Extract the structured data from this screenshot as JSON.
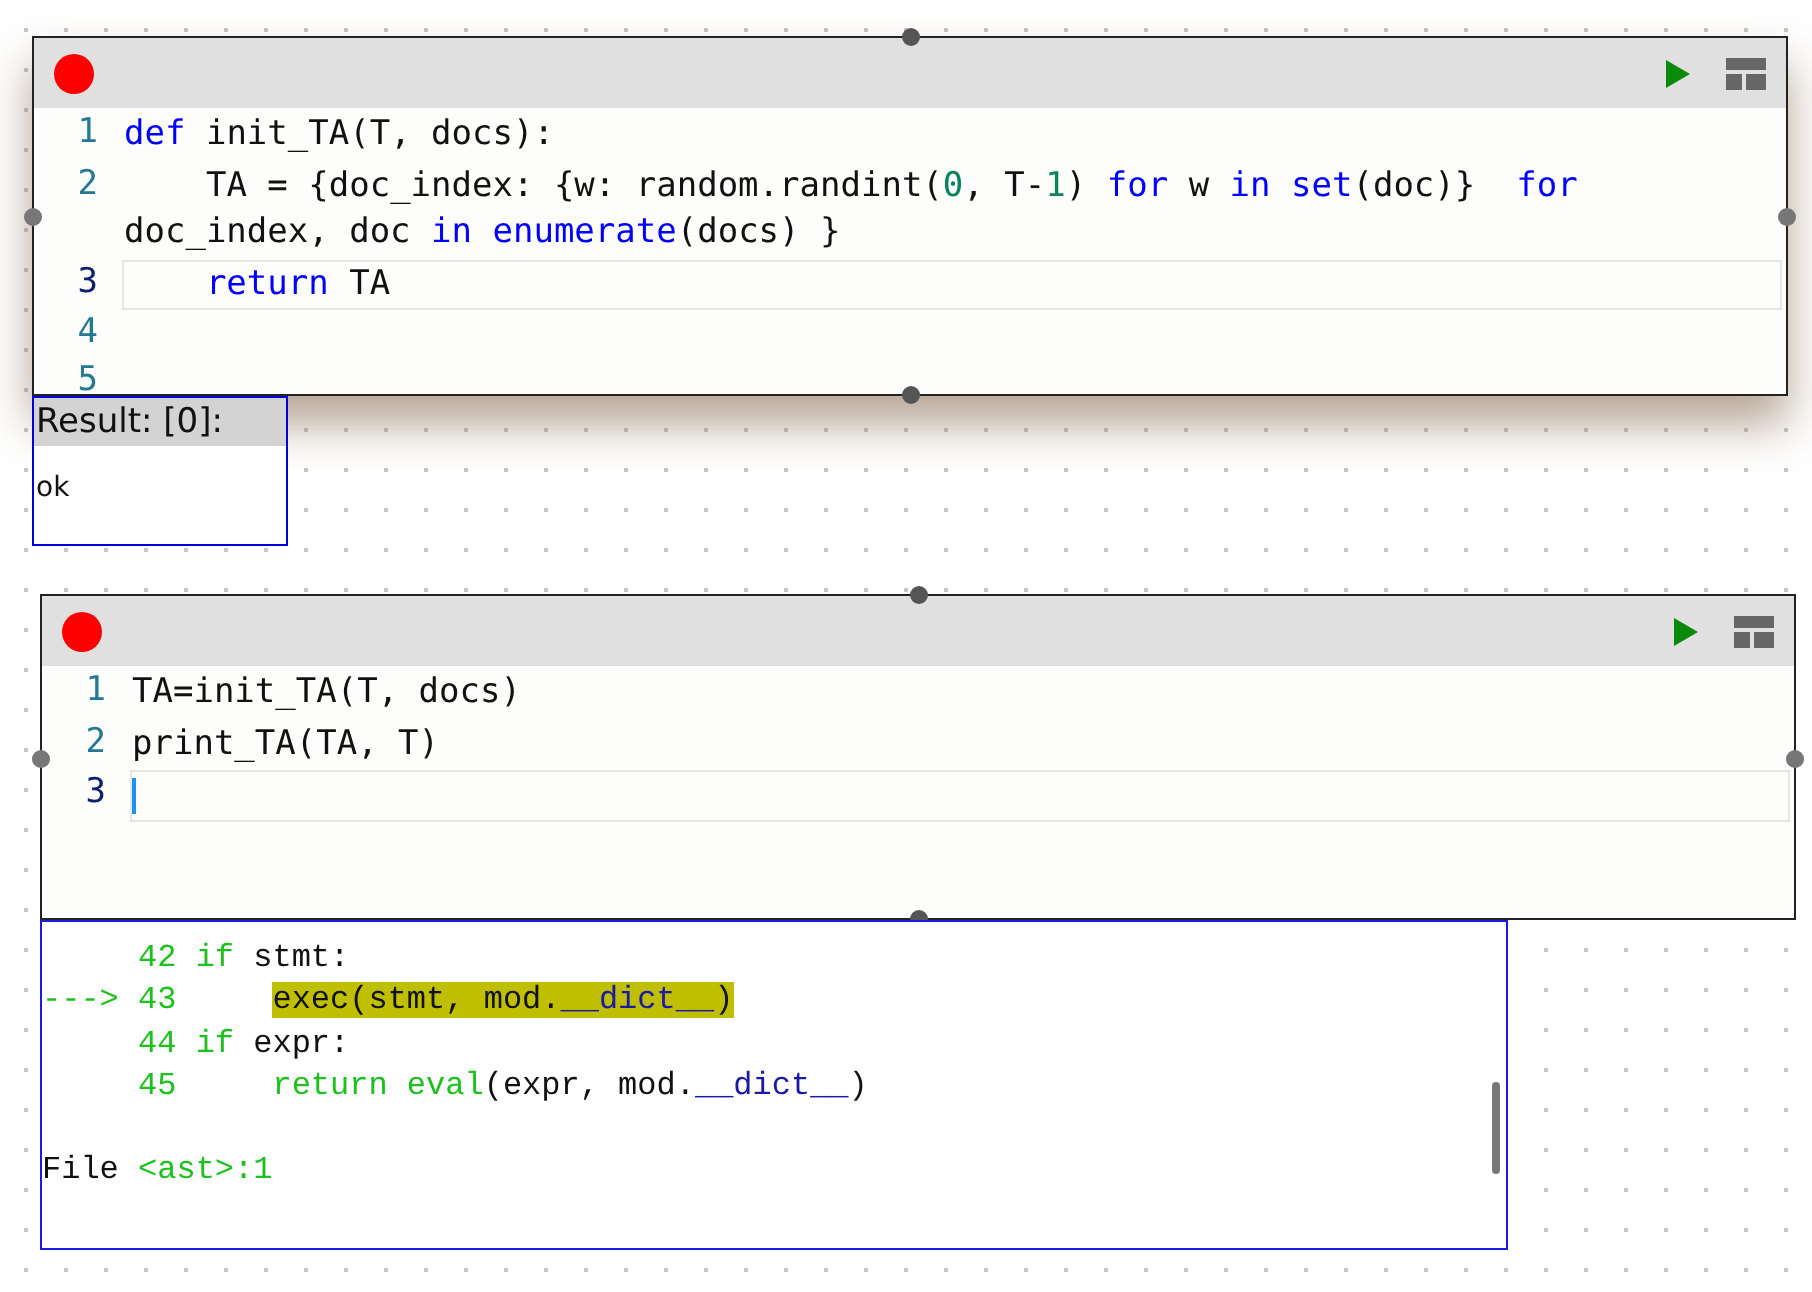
{
  "cells": [
    {
      "code_lines": [
        {
          "number": "1",
          "active": false,
          "tokens": [
            {
              "kind": "keyword",
              "text": "def"
            },
            {
              "kind": "plain",
              "text": " init_TA(T, docs):"
            }
          ]
        },
        {
          "number": "2",
          "active": false,
          "tokens": [
            {
              "kind": "plain",
              "text": "    TA = {doc_index: {w: random.randint("
            },
            {
              "kind": "number",
              "text": "0"
            },
            {
              "kind": "plain",
              "text": ", T-"
            },
            {
              "kind": "number",
              "text": "1"
            },
            {
              "kind": "plain",
              "text": ") "
            },
            {
              "kind": "keyword",
              "text": "for"
            },
            {
              "kind": "plain",
              "text": " w "
            },
            {
              "kind": "keyword",
              "text": "in set"
            },
            {
              "kind": "plain",
              "text": "(doc)}  "
            },
            {
              "kind": "keyword",
              "text": "for"
            },
            {
              "kind": "plain",
              "text": " doc_index, doc "
            },
            {
              "kind": "keyword",
              "text": "in enumerate"
            },
            {
              "kind": "plain",
              "text": "(docs) }"
            }
          ]
        },
        {
          "number": "3",
          "active": true,
          "indented": true,
          "tokens": [
            {
              "kind": "keyword",
              "text": "return"
            },
            {
              "kind": "plain",
              "text": " TA"
            }
          ]
        },
        {
          "number": "4",
          "active": false
        },
        {
          "number": "5",
          "active": false
        }
      ],
      "result": {
        "title": "Result: [0]:",
        "output": "ok"
      }
    },
    {
      "code_lines": [
        {
          "number": "1",
          "active": false,
          "tokens": [
            {
              "kind": "plain",
              "text": "TA=init_TA(T, docs)"
            }
          ]
        },
        {
          "number": "2",
          "active": false,
          "tokens": [
            {
              "kind": "plain",
              "text": "print_TA(TA, T)"
            }
          ]
        },
        {
          "number": "3",
          "active": true
        }
      ]
    }
  ],
  "traceback": {
    "lines": [
      {
        "kind": "source",
        "number": "42",
        "highlight": false,
        "indented": false,
        "tokens": [
          {
            "kind": "green",
            "text": "if"
          },
          {
            "kind": "plain",
            "text": " stmt:"
          }
        ]
      },
      {
        "kind": "source",
        "marker": "--->",
        "number": "43",
        "highlight": true,
        "indented": true,
        "tokens": [
          {
            "kind": "plain",
            "text": "exec(stmt, mod."
          },
          {
            "kind": "dunder",
            "text": "__dict__"
          },
          {
            "kind": "plain",
            "text": ")"
          }
        ]
      },
      {
        "kind": "source",
        "number": "44",
        "highlight": false,
        "indented": false,
        "tokens": [
          {
            "kind": "green",
            "text": "if"
          },
          {
            "kind": "plain",
            "text": " expr:"
          }
        ]
      },
      {
        "kind": "source",
        "number": "45",
        "highlight": false,
        "indented": true,
        "tokens": [
          {
            "kind": "green",
            "text": "return eval"
          },
          {
            "kind": "plain",
            "text": "(expr, mod."
          },
          {
            "kind": "dunder",
            "text": "__dict__"
          },
          {
            "kind": "plain",
            "text": ")"
          }
        ]
      },
      {
        "kind": "file",
        "tokens": [
          {
            "kind": "plain",
            "text": "File "
          },
          {
            "kind": "green",
            "text": "<ast>:1"
          }
        ]
      }
    ]
  }
}
